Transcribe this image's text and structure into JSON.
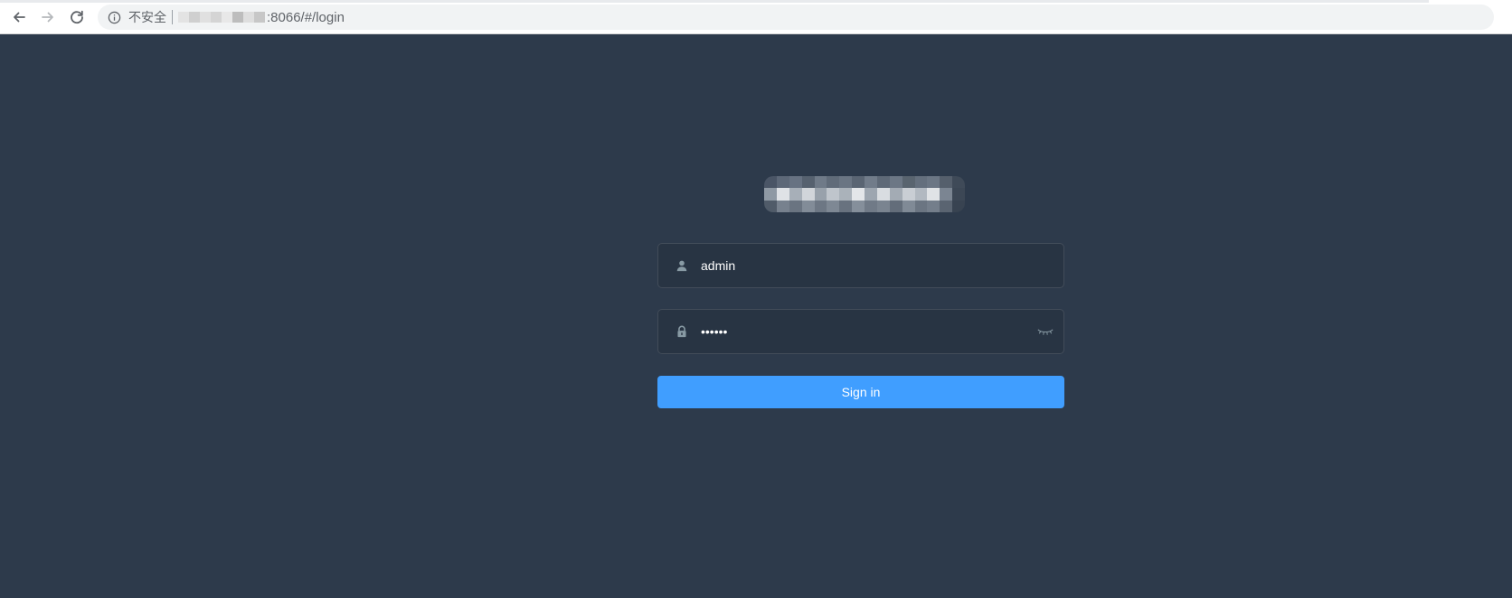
{
  "browser": {
    "security_label": "不安全",
    "url_suffix": ":8066/#/login"
  },
  "login": {
    "username_value": "admin",
    "password_value": "••••••",
    "signin_label": "Sign in"
  },
  "colors": {
    "page_background": "#2d3a4b",
    "input_background": "#283443",
    "primary_button": "#409eff"
  }
}
